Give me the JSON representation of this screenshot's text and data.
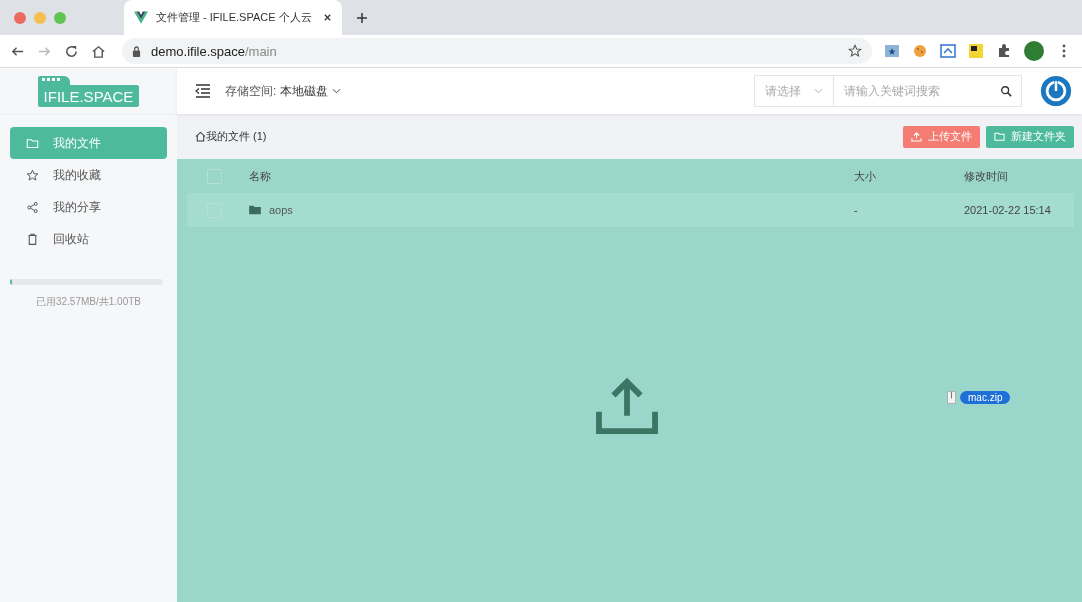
{
  "browser": {
    "tab_title": "文件管理 - IFILE.SPACE 个人云",
    "url_host": "demo.ifile.space",
    "url_path": "/main"
  },
  "logo": "IFILE.SPACE",
  "header": {
    "storage_label": "存储空间:",
    "storage_value": "本地磁盘",
    "select_placeholder": "请选择",
    "search_placeholder": "请输入关键词搜索"
  },
  "sidebar": {
    "items": [
      {
        "label": "我的文件",
        "selected": true
      },
      {
        "label": "我的收藏",
        "selected": false
      },
      {
        "label": "我的分享",
        "selected": false
      },
      {
        "label": "回收站",
        "selected": false
      }
    ],
    "usage": {
      "level": 0.01,
      "text": "已用32.57MB/共1.00TB"
    }
  },
  "breadcrumb": "我的文件 (1)",
  "buttons": [
    {
      "label": "上传文件",
      "kind": "upload"
    },
    {
      "label": "新建文件夹",
      "kind": "folder"
    }
  ],
  "table": {
    "columns": [
      "名称",
      "大小",
      "修改时间"
    ],
    "all_checked": false,
    "rows": [
      {
        "name": "aops",
        "size": "-",
        "modified": "2021-02-22 15:14",
        "checked": false
      }
    ]
  },
  "drag_file": "mac.zip"
}
